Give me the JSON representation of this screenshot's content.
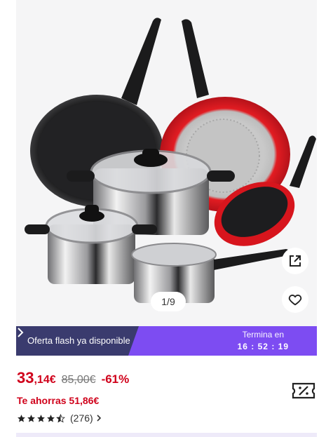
{
  "gallery": {
    "counter": "1/9",
    "icons": {
      "share": "share-external-icon",
      "favorite": "heart-outline-icon"
    }
  },
  "flash": {
    "label": "Oferta flash ya disponible",
    "ends_label": "Termina en",
    "timer": "16 : 52 : 19",
    "colors": {
      "banner": "#7d4cf2",
      "dark": "#3a3b6e"
    }
  },
  "price": {
    "integer": "33",
    "decimals": ",14€",
    "old": "85,00€",
    "discount": "-61%",
    "savings": "Te ahorras 51,86€",
    "accent": "#d0021b"
  },
  "rating": {
    "stars": 4.5,
    "max": 5,
    "reviews": "(276)"
  }
}
